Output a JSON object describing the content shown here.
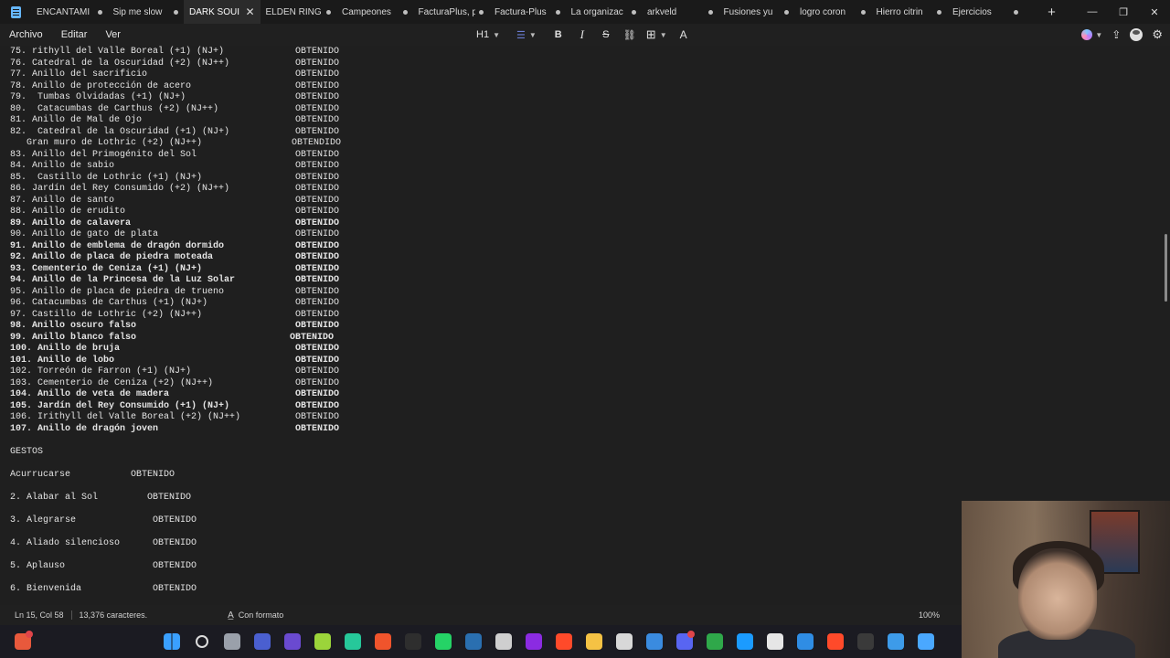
{
  "tabs": [
    {
      "label": "ENCANTAMI",
      "active": false
    },
    {
      "label": "Sip me slow",
      "active": false
    },
    {
      "label": "DARK SOUI",
      "active": true
    },
    {
      "label": "ELDEN RING",
      "active": false
    },
    {
      "label": "Campeones",
      "active": false
    },
    {
      "label": "FacturaPlus, por se",
      "active": false
    },
    {
      "label": "Factura-Plus",
      "active": false
    },
    {
      "label": "La organizac",
      "active": false
    },
    {
      "label": "arkveld",
      "active": false
    },
    {
      "label": "Fusiones yu",
      "active": false
    },
    {
      "label": "logro coron",
      "active": false
    },
    {
      "label": "Hierro citrin",
      "active": false
    },
    {
      "label": "Ejercicios",
      "active": false
    }
  ],
  "tab_add": "+",
  "window_controls": {
    "minimize": "—",
    "maximize": "❐",
    "close": "✕"
  },
  "menu": [
    "Archivo",
    "Editar",
    "Ver"
  ],
  "toolbar": {
    "heading": "H1",
    "list": "☰",
    "bold": "B",
    "italic": "I",
    "strike": "S",
    "link": "🔗",
    "table": "⊞",
    "clear": "A"
  },
  "document": {
    "list_lines": [
      {
        "text": "75. rithyll del Valle Boreal (+1) (NJ+)",
        "status": "OBTENIDO",
        "bold": false
      },
      {
        "text": "76. Catedral de la Oscuridad (+2) (NJ++)",
        "status": "OBTENIDO",
        "bold": false
      },
      {
        "text": "77. Anillo del sacrificio",
        "status": "OBTENIDO",
        "bold": false
      },
      {
        "text": "78. Anillo de protección de acero",
        "status": "OBTENIDO",
        "bold": false
      },
      {
        "text": "79.  Tumbas Olvidadas (+1) (NJ+)",
        "status": "OBTENIDO",
        "bold": false
      },
      {
        "text": "80.  Catacumbas de Carthus (+2) (NJ++)",
        "status": "OBTENIDO",
        "bold": false
      },
      {
        "text": "81. Anillo de Mal de Ojo",
        "status": "OBTENIDO",
        "bold": false
      },
      {
        "text": "82.  Catedral de la Oscuridad (+1) (NJ+)",
        "status": "OBTENIDO",
        "bold": false
      },
      {
        "text": "   Gran muro de Lothric (+2) (NJ++)",
        "status": "OBTENDIDO",
        "bold": false,
        "offset": -1
      },
      {
        "text": "83. Anillo del Primogénito del Sol",
        "status": "OBTENIDO",
        "bold": false
      },
      {
        "text": "84. Anillo de sabio",
        "status": "OBTENIDO",
        "bold": false
      },
      {
        "text": "85.  Castillo de Lothric (+1) (NJ+)",
        "status": "OBTENIDO",
        "bold": false
      },
      {
        "text": "86. Jardín del Rey Consumido (+2) (NJ++)",
        "status": "OBTENIDO",
        "bold": false
      },
      {
        "text": "87. Anillo de santo",
        "status": "OBTENIDO",
        "bold": false
      },
      {
        "text": "88. Anillo de erudito",
        "status": "OBTENIDO",
        "bold": false
      },
      {
        "text": "89. Anillo de calavera",
        "status": "OBTENIDO",
        "bold": true
      },
      {
        "text": "90. Anillo de gato de plata",
        "status": "OBTENIDO",
        "bold": false
      },
      {
        "text": "91. Anillo de emblema de dragón dormido",
        "status": "OBTENIDO",
        "bold": true
      },
      {
        "text": "92. Anillo de placa de piedra moteada",
        "status": "OBTENIDO",
        "bold": true
      },
      {
        "text": "93. Cementerio de Ceniza (+1) (NJ+)",
        "status": "OBTENIDO",
        "bold": true
      },
      {
        "text": "94. Anillo de la Princesa de la Luz Solar",
        "status": "OBTENIDO",
        "bold": true
      },
      {
        "text": "95. Anillo de placa de piedra de trueno",
        "status": "OBTENIDO",
        "bold": false
      },
      {
        "text": "96. Catacumbas de Carthus (+1) (NJ+)",
        "status": "OBTENIDO",
        "bold": false
      },
      {
        "text": "97. Castillo de Lothric (+2) (NJ++)",
        "status": "OBTENIDO",
        "bold": false
      },
      {
        "text": "98. Anillo oscuro falso",
        "status": "OBTENIDO",
        "bold": true
      },
      {
        "text": "99. Anillo blanco falso",
        "status": "OBTENIDO",
        "bold": true,
        "offset": -1
      },
      {
        "text": "100. Anillo de bruja",
        "status": "OBTENIDO",
        "bold": true
      },
      {
        "text": "101. Anillo de lobo",
        "status": "OBTENIDO",
        "bold": true
      },
      {
        "text": "102. Torreón de Farron (+1) (NJ+)",
        "status": "OBTENIDO",
        "bold": false
      },
      {
        "text": "103. Cementerio de Ceniza (+2) (NJ++)",
        "status": "OBTENIDO",
        "bold": false
      },
      {
        "text": "104. Anillo de veta de madera",
        "status": "OBTENIDO",
        "bold": true
      },
      {
        "text": "105. Jardín del Rey Consumido (+1) (NJ+)",
        "status": "OBTENIDO",
        "bold": true
      },
      {
        "text": "106. Irithyll del Valle Boreal (+2) (NJ++)",
        "status": "OBTENIDO",
        "bold": false
      },
      {
        "text": "107. Anillo de dragón joven",
        "status": "OBTENIDO",
        "bold": true
      }
    ],
    "section_title": "GESTOS",
    "gestures": [
      {
        "text": "Acurrucarse",
        "status": "OBTENIDO"
      },
      {
        "text": "2. Alabar al Sol",
        "status": "OBTENIDO"
      },
      {
        "text": "3. Alegrarse",
        "status": "OBTENIDO"
      },
      {
        "text": "4. Aliado silencioso",
        "status": "OBTENIDO"
      },
      {
        "text": "5. Aplauso",
        "status": "OBTENIDO"
      },
      {
        "text": "6. Bienvenida",
        "status": "OBTENIDO"
      }
    ]
  },
  "statusbar": {
    "position": "Ln 15, Col 58",
    "chars": "13,376 caracteres.",
    "format": "Con formato",
    "zoom": "100%"
  },
  "taskbar": {
    "icons": [
      {
        "name": "weather-icon",
        "color": "#e8593c"
      },
      {
        "name": "windows-start-icon",
        "color": "#3aa0ff"
      },
      {
        "name": "search-icon",
        "color": "#dcdcdc"
      },
      {
        "name": "task-view-icon",
        "color": "#9aa0aa"
      },
      {
        "name": "widgets-icon",
        "color": "#4a5fd0"
      },
      {
        "name": "media-player-icon",
        "color": "#6a4ad0"
      },
      {
        "name": "line-app-icon",
        "color": "#9bd43a"
      },
      {
        "name": "game-app-icon",
        "color": "#26c89a"
      },
      {
        "name": "brave-browser-icon",
        "color": "#f0542c"
      },
      {
        "name": "epic-games-icon",
        "color": "#2e2e2e"
      },
      {
        "name": "whatsapp-icon",
        "color": "#25d366"
      },
      {
        "name": "steam-icon",
        "color": "#2a6fb0"
      },
      {
        "name": "obs-icon",
        "color": "#cfcfcf"
      },
      {
        "name": "ring-app-icon",
        "color": "#8b2be2"
      },
      {
        "name": "ea-app-icon",
        "color": "#ff4a2a"
      },
      {
        "name": "file-explorer-icon",
        "color": "#f5c244"
      },
      {
        "name": "ubisoft-icon",
        "color": "#d8d8d8"
      },
      {
        "name": "store-icon",
        "color": "#3a8be0"
      },
      {
        "name": "discord-icon",
        "color": "#5865f2"
      },
      {
        "name": "xbox-icon",
        "color": "#2fa84a"
      },
      {
        "name": "battlenet-icon",
        "color": "#1b9bff"
      },
      {
        "name": "document-icon",
        "color": "#e6e6e6"
      },
      {
        "name": "snipping-icon",
        "color": "#2f8de4"
      },
      {
        "name": "ea-app2-icon",
        "color": "#ff4a2a"
      },
      {
        "name": "epic-games2-icon",
        "color": "#3a3a3a"
      },
      {
        "name": "photos-icon",
        "color": "#3d9be9"
      },
      {
        "name": "notepad-icon",
        "color": "#4aa8ff"
      }
    ]
  },
  "colors": {
    "background": "#1f1f1f",
    "tabbar": "#1a1a1a",
    "active_tab": "#2b2b2b",
    "text": "#e4e4e4",
    "taskbar": "#1b1b22"
  }
}
